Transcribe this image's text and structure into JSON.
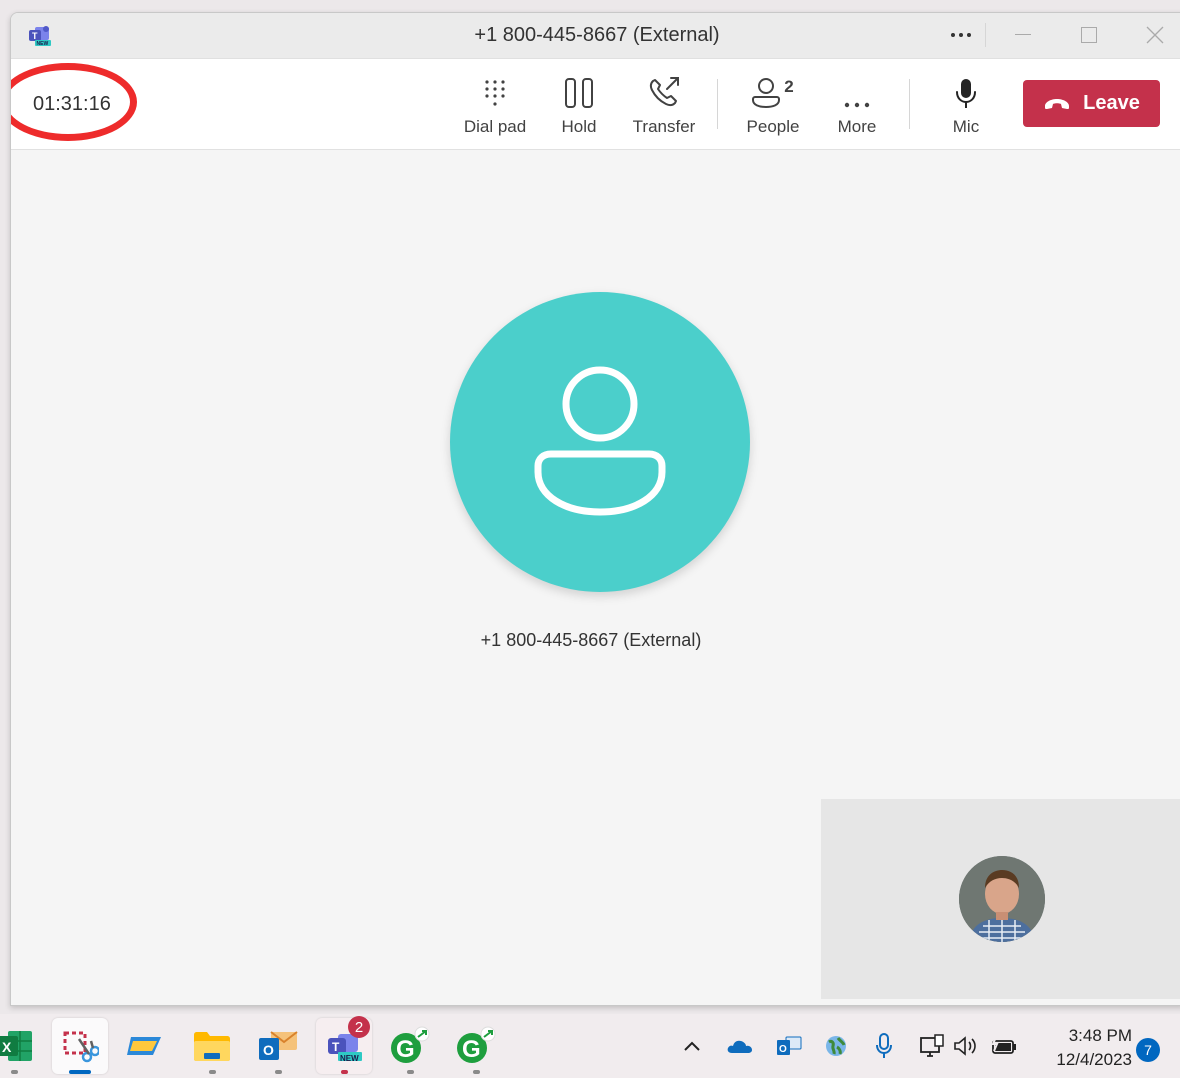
{
  "window": {
    "title": "+1 800-445-8667 (External)"
  },
  "call": {
    "timer": "01:31:16",
    "caller_name": "+1 800-445-8667 (External)",
    "people_count": "2",
    "avatar_color": "#4bcfcb"
  },
  "toolbar": {
    "dialpad_label": "Dial pad",
    "hold_label": "Hold",
    "transfer_label": "Transfer",
    "people_label": "People",
    "more_label": "More",
    "mic_label": "Mic",
    "leave_label": "Leave",
    "leave_color": "#c4314b"
  },
  "annotation": {
    "highlight_color": "#ee2b2b"
  },
  "taskbar": {
    "teams_badge": "2",
    "teams_new_label": "NEW",
    "time": "3:48 PM",
    "date": "12/4/2023",
    "notification_count": "7"
  }
}
